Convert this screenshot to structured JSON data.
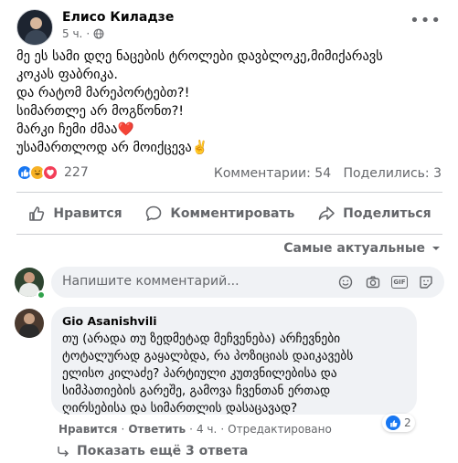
{
  "post": {
    "author": "Елисо Киладзе",
    "time": "5 ч.",
    "privacy_separator": "·",
    "privacy_icon": "globe-icon",
    "more_icon": "more-dots-icon",
    "lines": [
      "მე ეს სამი დღე ნაცების ტროლები დავბლოკე,მიმიქარავს",
      "კოკას ფაბრიკა.",
      "და რატომ მარეპორტებთ?!",
      "სიმართლე არ მოგწონთ?!",
      "მარკი ჩემი ძმაა❤️",
      "უსამართლოდ არ მოიქცევა✌️"
    ]
  },
  "summary": {
    "reaction_icons": [
      "like-icon",
      "haha-icon",
      "love-icon"
    ],
    "reaction_count": "227",
    "comments": "Комментарии: 54",
    "shares": "Поделились: 3"
  },
  "actions": {
    "like": "Нравится",
    "comment": "Комментировать",
    "share": "Поделиться"
  },
  "sort": {
    "label": "Самые актуальные"
  },
  "composer": {
    "placeholder": "Напишите комментарий...",
    "icons": [
      "emoji-icon",
      "camera-icon",
      "gif-icon",
      "sticker-icon"
    ],
    "gif_label": "GIF"
  },
  "comment": {
    "author": "Gio Asanishvili",
    "lines": [
      "თუ (არადა თუ ზედმეტად მეჩვენება) არჩევნები",
      "ტოტალურად გაყალბდა, რა პოზიციას დაიკავებს",
      "ელისო კილაძე? პარტიული კუთვნილებისა და",
      "სიმპათიების გარეშე, გამოვა ჩვენთან ერთად",
      "ღირსებისა და სიმართლის დასაცავად?"
    ],
    "like_count": "2",
    "like_label": "Нравится",
    "reply_label": "Ответить",
    "time": "4 ч.",
    "edited": "Отредактировано",
    "separator": "·"
  },
  "replies": {
    "label": "Показать ещё 3 ответа"
  }
}
